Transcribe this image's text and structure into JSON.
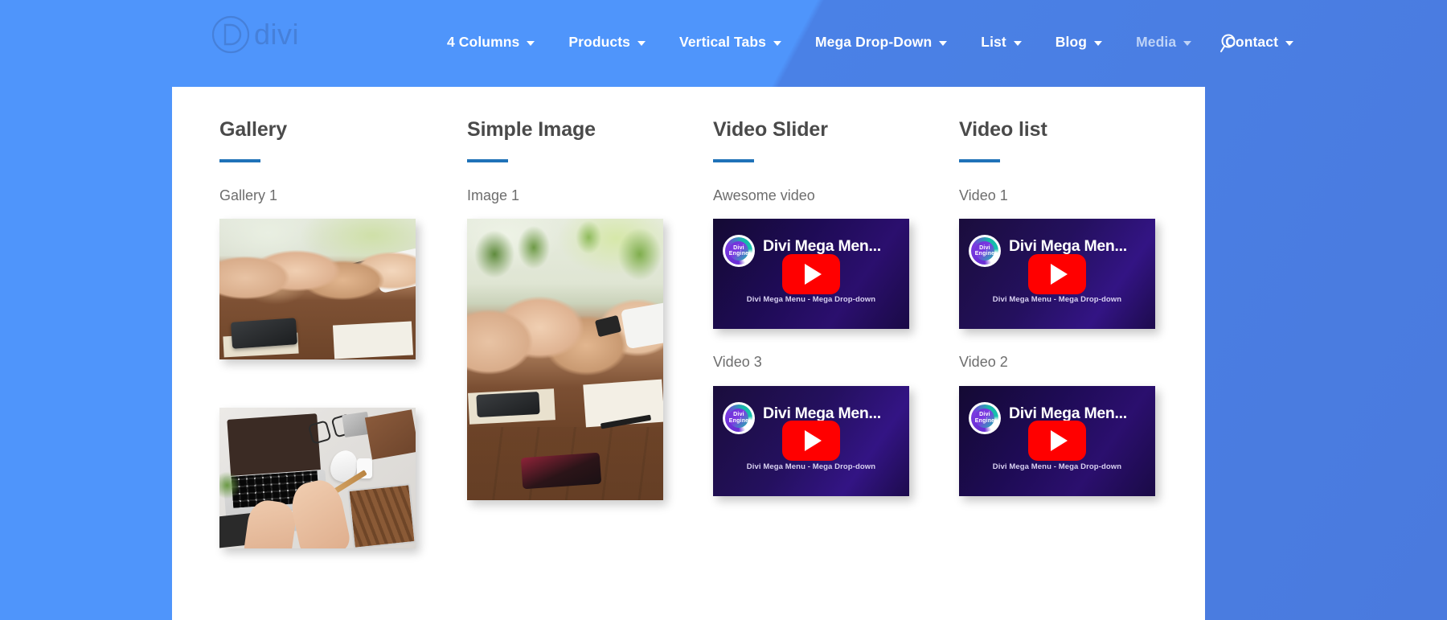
{
  "header": {
    "logo": {
      "mark": "divi-logo-mark",
      "letter": "D",
      "word": "divi"
    },
    "nav_items": [
      {
        "label": "4 Columns",
        "has_caret": true,
        "state": "normal"
      },
      {
        "label": "Products",
        "has_caret": true,
        "state": "normal"
      },
      {
        "label": "Vertical Tabs",
        "has_caret": true,
        "state": "normal"
      },
      {
        "label": "Mega Drop-Down",
        "has_caret": true,
        "state": "normal"
      },
      {
        "label": "List",
        "has_caret": true,
        "state": "normal"
      },
      {
        "label": "Blog",
        "has_caret": true,
        "state": "normal"
      },
      {
        "label": "Media",
        "has_caret": true,
        "state": "dim"
      },
      {
        "label": "Contact",
        "has_caret": true,
        "state": "normal"
      }
    ],
    "search_icon": "search-icon"
  },
  "colors": {
    "page_blue_light": "#4f95fb",
    "page_blue_dark": "#4a7ade",
    "card_white": "#ffffff",
    "rule_blue": "#1f72b8",
    "heading_gray": "#4a4a4a",
    "label_gray": "#6d6d6d",
    "play_red": "#ff0000"
  },
  "columns": [
    {
      "title": "Gallery",
      "items": [
        {
          "label": "Gallery 1",
          "kind": "photo",
          "subject": "hands-stacked-teamwork-on-desk"
        },
        {
          "label": "",
          "kind": "photo",
          "subject": "laptop-desk-flatlay"
        }
      ]
    },
    {
      "title": "Simple Image",
      "items": [
        {
          "label": "Image 1",
          "kind": "photo",
          "subject": "hands-stacked-teamwork-portrait"
        }
      ]
    },
    {
      "title": "Video Slider",
      "items": [
        {
          "label": "Awesome video",
          "kind": "video"
        },
        {
          "label": "Video 3",
          "kind": "video"
        }
      ]
    },
    {
      "title": "Video list",
      "items": [
        {
          "label": "Video 1",
          "kind": "video"
        },
        {
          "label": "Video 2",
          "kind": "video"
        }
      ]
    }
  ],
  "video_thumb": {
    "logo_line1": "Divi",
    "logo_line2": "Engine",
    "title": "Divi Mega Men...",
    "subtitle": "Divi Mega Menu - Mega Drop-down",
    "play_icon": "play-button-icon"
  }
}
